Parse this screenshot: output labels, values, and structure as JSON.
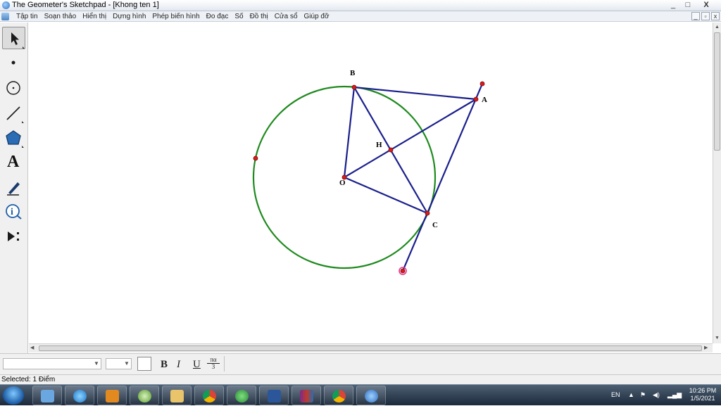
{
  "window": {
    "title": "The Geometer's Sketchpad - [Khong ten 1]",
    "controls": {
      "minimize": "_",
      "maximize": "□",
      "close": "X"
    }
  },
  "menubar": {
    "items": [
      "Tập tin",
      "Soạn thảo",
      "Hiển thị",
      "Dựng hình",
      "Phép biến hình",
      "Đo đạc",
      "Số",
      "Đồ thị",
      "Cửa sổ",
      "Giúp đỡ"
    ],
    "doc_controls": {
      "minimize": "_",
      "restore": "▫",
      "close": "x"
    }
  },
  "toolbox": {
    "tools": [
      {
        "name": "arrow-select-tool",
        "selected": true
      },
      {
        "name": "point-tool",
        "selected": false
      },
      {
        "name": "compass-tool",
        "selected": false
      },
      {
        "name": "straightedge-tool",
        "selected": false
      },
      {
        "name": "polygon-tool",
        "selected": false
      },
      {
        "name": "text-tool",
        "selected": false,
        "glyph": "A"
      },
      {
        "name": "marker-tool",
        "selected": false
      },
      {
        "name": "information-tool",
        "selected": false,
        "glyph": "i"
      },
      {
        "name": "custom-tool",
        "selected": false
      }
    ]
  },
  "sketch": {
    "colors": {
      "circle": "#1e8a1e",
      "segment": "#1a1f8c",
      "point": "#d81b1b",
      "selected_point": "#e0338c"
    },
    "labels": {
      "A": "A",
      "B": "B",
      "C": "C",
      "H": "H",
      "O": "O"
    }
  },
  "texttoolbar": {
    "font_family_value": "",
    "font_size_value": "",
    "bold": "B",
    "italic": "I",
    "underline": "U",
    "math_format_top": "πα",
    "math_format_bottom": "3"
  },
  "statusbar": {
    "text": "Selected: 1 Điểm"
  },
  "taskbar": {
    "apps": [
      "file-manager",
      "internet-explorer",
      "media-player",
      "geogebra",
      "explorer-folder",
      "chrome-beta",
      "parrot-app",
      "word",
      "winrar",
      "chrome",
      "sketchpad"
    ],
    "tray": {
      "language": "EN",
      "time": "10:26 PM",
      "date": "1/5/2021"
    }
  }
}
